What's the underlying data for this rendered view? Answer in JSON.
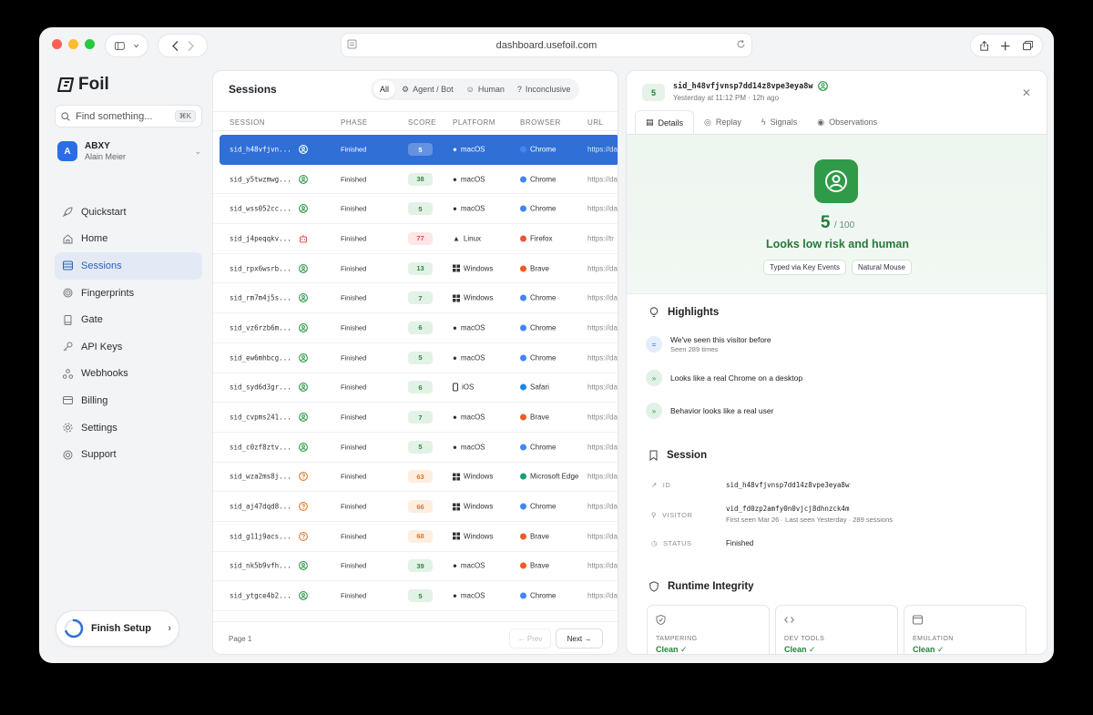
{
  "browser": {
    "url": "dashboard.usefoil.com"
  },
  "sidebar": {
    "logo": "Foil",
    "search_placeholder": "Find something...",
    "search_shortcut": "⌘K",
    "account": {
      "initial": "A",
      "name": "ABXY",
      "user": "Alain Meier"
    },
    "items": [
      {
        "label": "Quickstart",
        "icon": "rocket-icon"
      },
      {
        "label": "Home",
        "icon": "home-icon"
      },
      {
        "label": "Sessions",
        "icon": "sessions-icon",
        "active": true
      },
      {
        "label": "Fingerprints",
        "icon": "fingerprint-icon"
      },
      {
        "label": "Gate",
        "icon": "gate-icon"
      },
      {
        "label": "API Keys",
        "icon": "key-icon"
      },
      {
        "label": "Webhooks",
        "icon": "webhook-icon"
      },
      {
        "label": "Billing",
        "icon": "billing-icon"
      },
      {
        "label": "Settings",
        "icon": "gear-icon"
      },
      {
        "label": "Support",
        "icon": "support-icon"
      }
    ],
    "finish_setup": "Finish Setup"
  },
  "sessions": {
    "title": "Sessions",
    "filters": [
      "All",
      "Agent / Bot",
      "Human",
      "Inconclusive"
    ],
    "columns": [
      "SESSION",
      "PHASE",
      "SCORE",
      "PLATFORM",
      "BROWSER",
      "URL"
    ],
    "rows": [
      {
        "id": "sid_h48vfjvn...",
        "type": "human",
        "phase": "Finished",
        "score": "5",
        "level": "low",
        "platform": "macOS",
        "browser": "Chrome",
        "url": "https://da"
      },
      {
        "id": "sid_y5twzmwg...",
        "type": "human",
        "phase": "Finished",
        "score": "38",
        "level": "low",
        "platform": "macOS",
        "browser": "Chrome",
        "url": "https://da"
      },
      {
        "id": "sid_wss052cc...",
        "type": "human",
        "phase": "Finished",
        "score": "5",
        "level": "low",
        "platform": "macOS",
        "browser": "Chrome",
        "url": "https://da"
      },
      {
        "id": "sid_j4peqqkv...",
        "type": "bot",
        "phase": "Finished",
        "score": "77",
        "level": "high",
        "platform": "Linux",
        "browser": "Firefox",
        "url": "https://tr"
      },
      {
        "id": "sid_rpx6wsrb...",
        "type": "human",
        "phase": "Finished",
        "score": "13",
        "level": "low",
        "platform": "Windows",
        "browser": "Brave",
        "url": "https://da"
      },
      {
        "id": "sid_rm7m4j5s...",
        "type": "human",
        "phase": "Finished",
        "score": "7",
        "level": "low",
        "platform": "Windows",
        "browser": "Chrome",
        "url": "https://da"
      },
      {
        "id": "sid_vz6rzb6m...",
        "type": "human",
        "phase": "Finished",
        "score": "6",
        "level": "low",
        "platform": "macOS",
        "browser": "Chrome",
        "url": "https://da"
      },
      {
        "id": "sid_ew6mhbcg...",
        "type": "human",
        "phase": "Finished",
        "score": "5",
        "level": "low",
        "platform": "macOS",
        "browser": "Chrome",
        "url": "https://da"
      },
      {
        "id": "sid_syd6d3gr...",
        "type": "human",
        "phase": "Finished",
        "score": "6",
        "level": "low",
        "platform": "iOS",
        "browser": "Safari",
        "url": "https://da"
      },
      {
        "id": "sid_cvpms241...",
        "type": "human",
        "phase": "Finished",
        "score": "7",
        "level": "low",
        "platform": "macOS",
        "browser": "Brave",
        "url": "https://da"
      },
      {
        "id": "sid_c0zf8ztv...",
        "type": "human",
        "phase": "Finished",
        "score": "5",
        "level": "low",
        "platform": "macOS",
        "browser": "Chrome",
        "url": "https://da"
      },
      {
        "id": "sid_wza2ms8j...",
        "type": "inconclusive",
        "phase": "Finished",
        "score": "63",
        "level": "mid",
        "platform": "Windows",
        "browser": "Microsoft Edge",
        "url": "https://da"
      },
      {
        "id": "sid_aj47dqd8...",
        "type": "inconclusive",
        "phase": "Finished",
        "score": "66",
        "level": "mid",
        "platform": "Windows",
        "browser": "Chrome",
        "url": "https://da"
      },
      {
        "id": "sid_g11j9acs...",
        "type": "inconclusive",
        "phase": "Finished",
        "score": "68",
        "level": "mid",
        "platform": "Windows",
        "browser": "Brave",
        "url": "https://da"
      },
      {
        "id": "sid_nk5b9vfh...",
        "type": "human",
        "phase": "Finished",
        "score": "39",
        "level": "low",
        "platform": "macOS",
        "browser": "Brave",
        "url": "https://da"
      },
      {
        "id": "sid_ytgce4b2...",
        "type": "human",
        "phase": "Finished",
        "score": "5",
        "level": "low",
        "platform": "macOS",
        "browser": "Chrome",
        "url": "https://da"
      }
    ],
    "page_label": "Page 1",
    "prev": "← Prev",
    "next": "Next →"
  },
  "detail": {
    "score": "5",
    "session_id": "sid_h48vfjvnsp7dd14z8vpe3eya8w",
    "time": "Yesterday at 11:12 PM · 12h ago",
    "tabs": [
      "Details",
      "Replay",
      "Signals",
      "Observations"
    ],
    "hero": {
      "score": "5",
      "max": "/ 100",
      "verdict": "Looks low risk and human",
      "chips": [
        "Typed via Key Events",
        "Natural Mouse"
      ]
    },
    "highlights_title": "Highlights",
    "highlights": [
      {
        "title": "We've seen this visitor before",
        "sub": "Seen 289 times"
      },
      {
        "title": "Looks like a real Chrome on a desktop",
        "sub": ""
      },
      {
        "title": "Behavior looks like a real user",
        "sub": ""
      }
    ],
    "session_title": "Session",
    "session_fields": {
      "id_label": "ID",
      "id_value": "sid_h48vfjvnsp7dd14z8vpe3eya8w",
      "visitor_label": "VISITOR",
      "visitor_value": "vid_fd0zp2amfy0n0vjcj8dhnzck4m",
      "visitor_sub": "First seen Mar 26 · Last seen Yesterday · 289 sessions",
      "status_label": "STATUS",
      "status_value": "Finished"
    },
    "runtime_title": "Runtime Integrity",
    "runtime": [
      {
        "label": "TAMPERING",
        "value": "Clean ✓"
      },
      {
        "label": "DEV TOOLS",
        "value": "Clean ✓"
      },
      {
        "label": "EMULATION",
        "value": "Clean ✓"
      }
    ]
  },
  "colors": {
    "accent": "#2f6fd6",
    "green": "#2f9a48",
    "orange": "#e07b2a",
    "red": "#e0524d"
  }
}
